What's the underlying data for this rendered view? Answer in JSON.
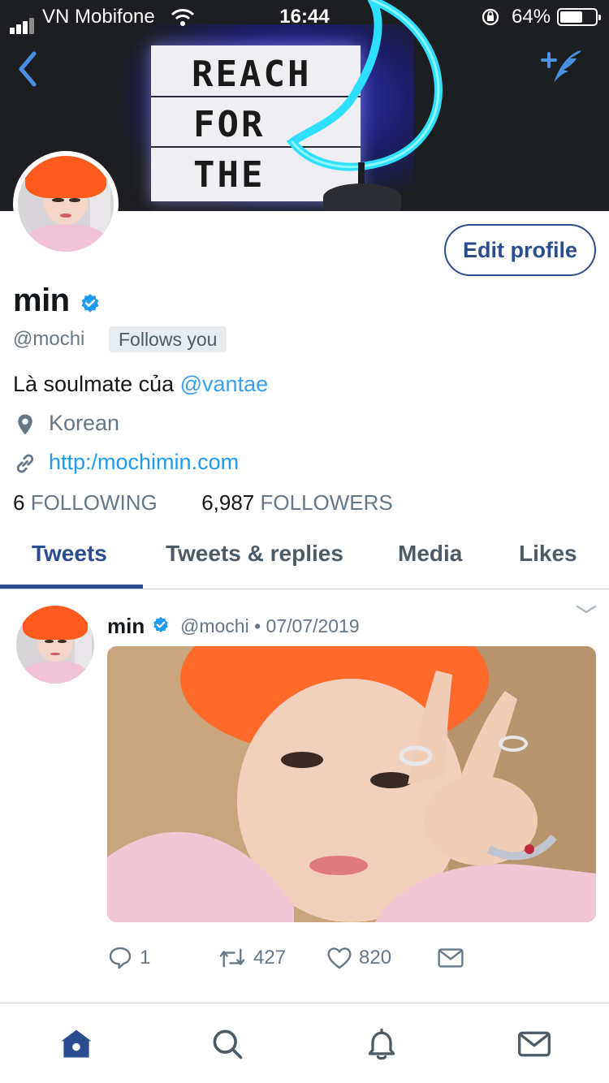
{
  "status_bar": {
    "carrier": "VN Mobifone",
    "time": "16:44",
    "battery_percent": "64%",
    "battery_level": 0.64,
    "signal_bars": 4,
    "signal_bars_active": 3
  },
  "header": {
    "banner_text": [
      "REACH",
      "FOR",
      "THE"
    ],
    "back_icon": "chevron-left-icon",
    "compose_icon": "feather-plus-icon"
  },
  "profile": {
    "edit_button_label": "Edit profile",
    "name": "min",
    "handle": "@mochi",
    "follows_you_label": "Follows you",
    "bio_text": "Là soulmate của ",
    "bio_mention": "@vantae",
    "location": "Korean",
    "website": "http:/mochimin.com",
    "following_count": "6",
    "following_label": "FOLLOWING",
    "followers_count": "6,987",
    "followers_label": "FOLLOWERS"
  },
  "tabs": [
    {
      "label": "Tweets",
      "active": true
    },
    {
      "label": "Tweets & replies",
      "active": false
    },
    {
      "label": "Media",
      "active": false
    },
    {
      "label": "Likes",
      "active": false
    }
  ],
  "tweet": {
    "name": "min",
    "handle_date": "@mochi • 07/07/2019",
    "reply_count": "1",
    "retweet_count": "427",
    "like_count": "820"
  },
  "bottom_nav": [
    "home-icon",
    "search-icon",
    "notifications-icon",
    "messages-icon"
  ],
  "colors": {
    "accent": "#2a4d8f",
    "link": "#1d9bf0",
    "verified": "#1d9bf0",
    "muted": "#657786"
  }
}
